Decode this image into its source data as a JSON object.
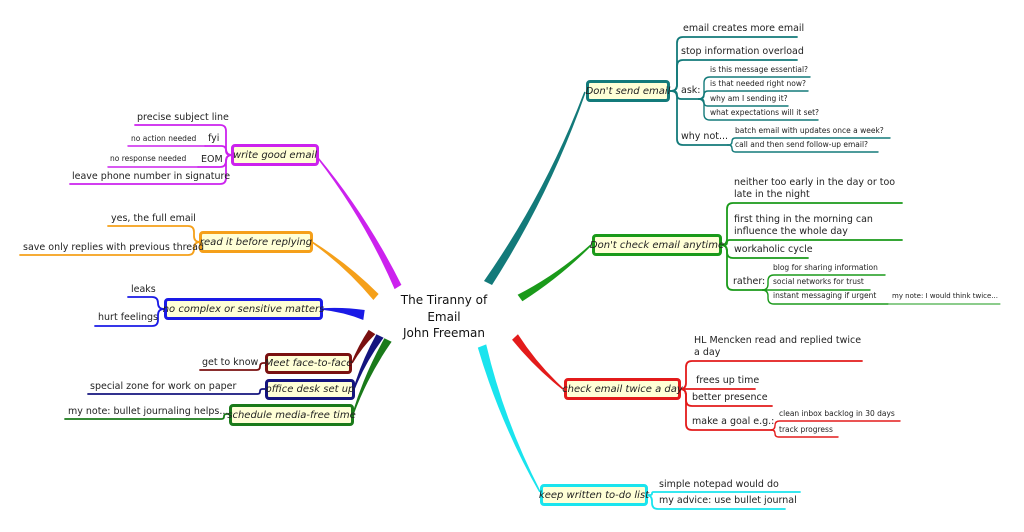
{
  "center": {
    "line1": "The Tiranny of",
    "line2": "Email",
    "line3": "John Freeman"
  },
  "branches": [
    {
      "label": "Don't send email",
      "color": "#137a7a",
      "children": [
        {
          "text": "email creates more email"
        },
        {
          "text": "stop information overload"
        },
        {
          "text": "ask:",
          "children": [
            "is this message essential?",
            "is that needed right now?",
            "why am I sending it?",
            "what expectations will it set?"
          ]
        },
        {
          "text": "why not...",
          "children": [
            "batch email with updates once a week?",
            "call and then send follow-up email?"
          ]
        }
      ]
    },
    {
      "label": "Don't check email anytime",
      "color": "#1a9a1a",
      "children": [
        {
          "text": "neither too early in the day or too late in the night"
        },
        {
          "text": "first thing in the morning can influence the whole day"
        },
        {
          "text": "workaholic cycle"
        },
        {
          "text": "rather:",
          "children": [
            "blog for sharing information",
            "social networks for trust",
            "instant messaging if urgent"
          ],
          "note": "my note: I would think twice..."
        }
      ]
    },
    {
      "label": "check email twice a day",
      "color": "#e31b1b",
      "children": [
        {
          "text": "HL Mencken read and replied twice a day"
        },
        {
          "text": "frees up time"
        },
        {
          "text": "better presence"
        },
        {
          "text": "make a goal e.g.:",
          "children": [
            "clean inbox backlog in 30 days",
            "track progress"
          ]
        }
      ]
    },
    {
      "label": "keep written to-do list",
      "color": "#1ae4ee",
      "children": [
        {
          "text": "simple notepad would do"
        },
        {
          "text": "my advice: use bullet journal"
        }
      ]
    },
    {
      "label": "write good email",
      "color": "#cc22ee",
      "children": [
        {
          "text": "precise subject line"
        },
        {
          "text": "fyi",
          "children": [
            "no action needed"
          ]
        },
        {
          "text": "EOM",
          "children": [
            "no response needed"
          ]
        },
        {
          "text": "leave phone number in signature"
        }
      ]
    },
    {
      "label": "read it before replying",
      "color": "#f5a01a",
      "children": [
        {
          "text": "yes, the full email"
        },
        {
          "text": "save only replies with previous thread"
        }
      ]
    },
    {
      "label": "no complex or sensitive matters",
      "color": "#1a1ae6",
      "children": [
        {
          "text": "leaks"
        },
        {
          "text": "hurt feelings"
        }
      ]
    },
    {
      "label": "Meet face-to-face",
      "color": "#7a1010",
      "children": [
        {
          "text": "get to know"
        }
      ]
    },
    {
      "label": "office desk set up",
      "color": "#14147e",
      "children": [
        {
          "text": "special zone for work on paper"
        }
      ]
    },
    {
      "label": "schedule media-free time",
      "color": "#1a7a1a",
      "children": [
        {
          "text": "my note: bullet journaling helps..."
        }
      ]
    }
  ]
}
